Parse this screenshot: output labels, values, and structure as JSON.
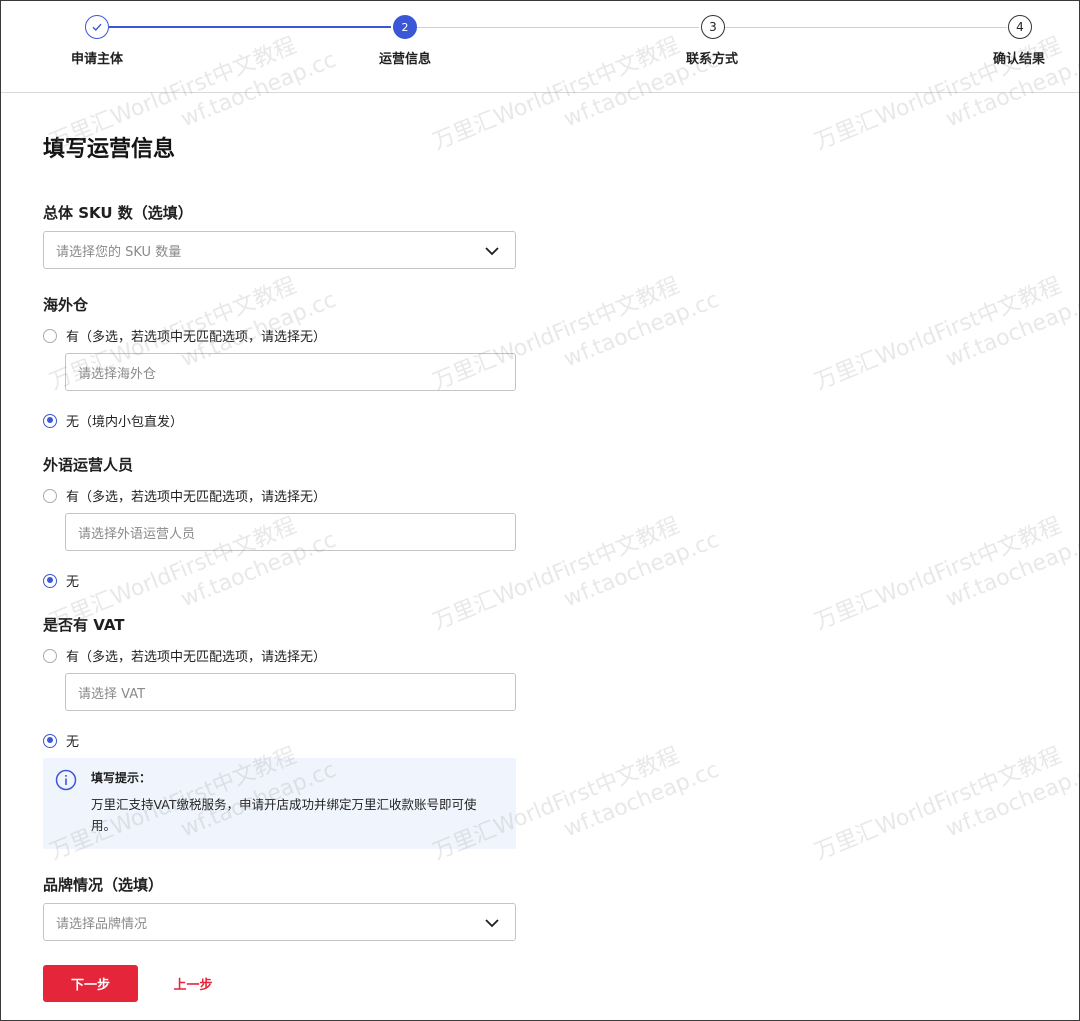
{
  "stepper": {
    "steps": [
      {
        "label": "申请主体",
        "number": "1",
        "state": "done"
      },
      {
        "label": "运营信息",
        "number": "2",
        "state": "active"
      },
      {
        "label": "联系方式",
        "number": "3",
        "state": "pending"
      },
      {
        "label": "确认结果",
        "number": "4",
        "state": "pending"
      }
    ]
  },
  "page": {
    "title": "填写运营信息"
  },
  "sku": {
    "label": "总体 SKU 数（选填）",
    "placeholder": "请选择您的 SKU 数量"
  },
  "warehouse": {
    "label": "海外仓",
    "option_yes": "有（多选，若选项中无匹配选项，请选择无）",
    "input_placeholder": "请选择海外仓",
    "option_no": "无（境内小包直发）",
    "selected": "no"
  },
  "staff": {
    "label": "外语运营人员",
    "option_yes": "有（多选，若选项中无匹配选项，请选择无）",
    "input_placeholder": "请选择外语运营人员",
    "option_no": "无",
    "selected": "no"
  },
  "vat": {
    "label": "是否有 VAT",
    "option_yes": "有（多选，若选项中无匹配选项，请选择无）",
    "input_placeholder": "请选择 VAT",
    "option_no": "无",
    "selected": "no"
  },
  "tip": {
    "title": "填写提示：",
    "text": "万里汇支持VAT缴税服务，申请开店成功并绑定万里汇收款账号即可使用。"
  },
  "brand": {
    "label": "品牌情况（选填）",
    "placeholder": "请选择品牌情况"
  },
  "actions": {
    "next": "下一步",
    "prev": "上一步"
  },
  "watermark": {
    "line1": "万里汇WorldFirst中文教程",
    "line2": "wf.taocheap.cc"
  },
  "colors": {
    "accent": "#3b57d6",
    "primary_button": "#e5263a",
    "tip_background": "#f0f5fd"
  }
}
